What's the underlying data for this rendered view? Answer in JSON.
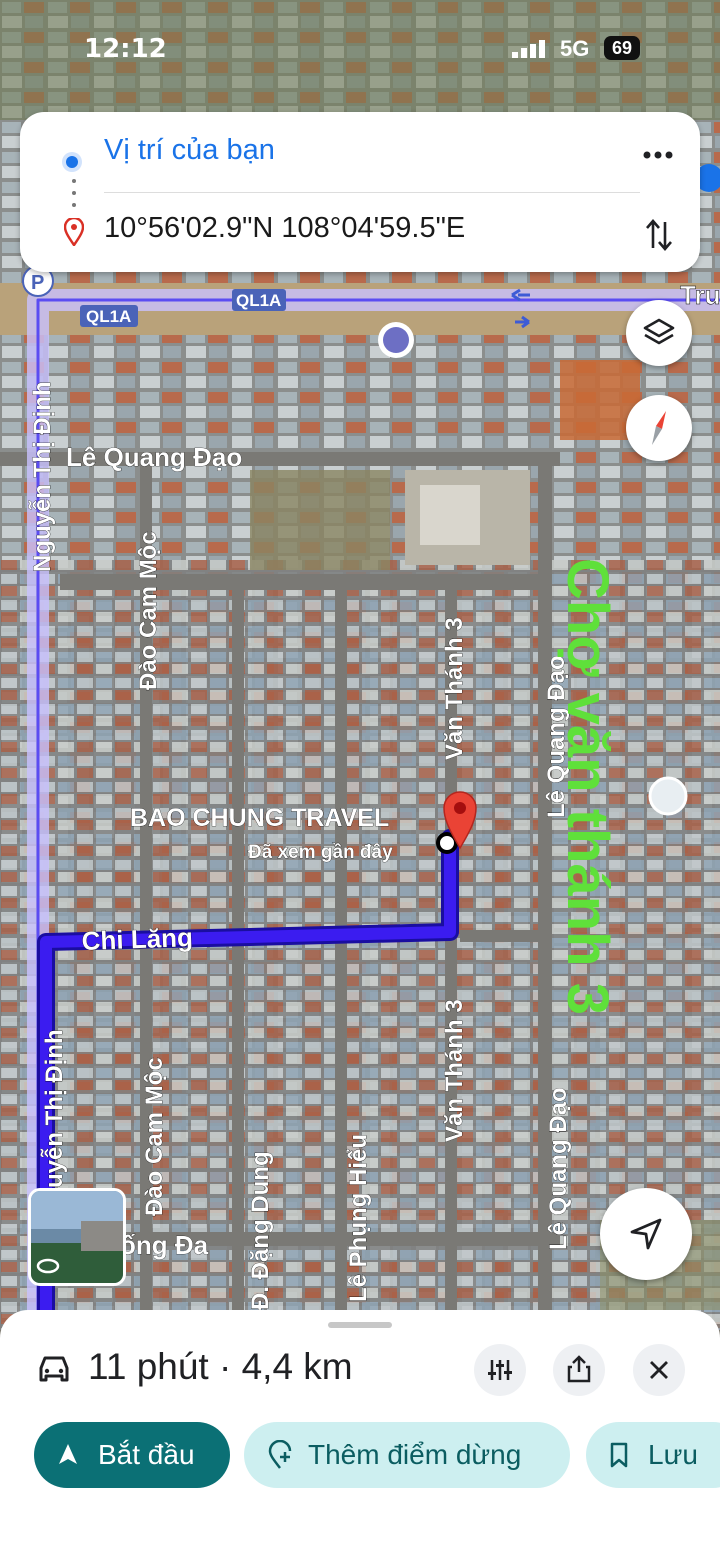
{
  "status_bar": {
    "time": "12:12",
    "network": "5G",
    "battery": "69"
  },
  "route": {
    "origin": "Vị trí của bạn",
    "destination": "10°56'02.9\"N 108°04'59.5\"E"
  },
  "map": {
    "highway_labels": [
      "QL1A",
      "QL1A"
    ],
    "edge_label": "Tru",
    "streets": {
      "nguyen_thi_dinh_top": "Nguyễn Thị Định",
      "nguyen_thi_dinh_bottom": "Nguyễn Thị Định",
      "le_quang_dao_top": "Lê Quang Đạo",
      "le_quang_dao_mid": "Lê Quang Đạo",
      "le_quang_dao_bottom": "Lê Quang Đạo",
      "dao_cam_moc_top": "Đào Cam Mộc",
      "dao_cam_moc_bottom": "Đào Cam Mộc",
      "van_thanh_top": "Văn Thánh 3",
      "van_thanh_bottom": "Văn Thánh 3",
      "chi_lang": "Chi Lăng",
      "dang_dung": "Đ. Đặng Dung",
      "le_phung_hieu": "Lê Phụng Hiểu",
      "dong_da": "ống Đa"
    },
    "place_name": "BAO CHUNG TRAVEL",
    "place_sub": "Đã xem gần đây",
    "annotation": "Chợ văn thánh 3"
  },
  "trip": {
    "summary": "11 phút · 4,4 km"
  },
  "actions": {
    "start": "Bắt đầu",
    "add_stop": "Thêm điểm dừng",
    "save": "Lưu"
  },
  "colors": {
    "route": "#3b1cf0",
    "accent_teal": "#0b7075",
    "pin": "#ea4335",
    "annotation": "#5fe03a"
  }
}
